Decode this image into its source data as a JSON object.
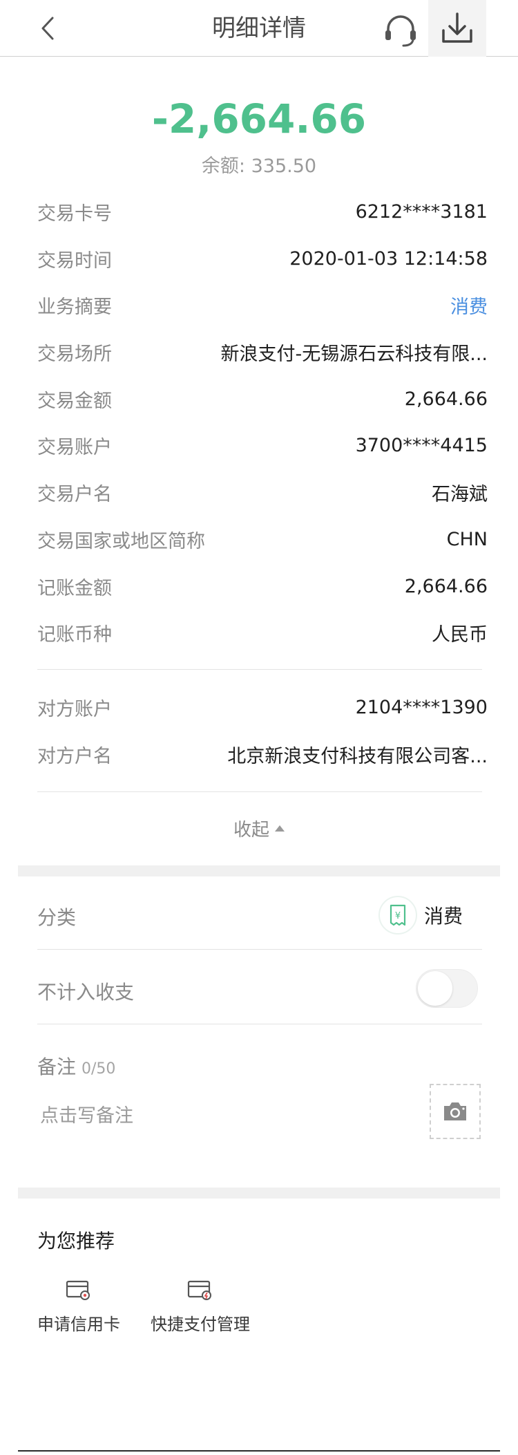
{
  "header": {
    "title": "明细详情",
    "back_icon": "chevron-left-icon",
    "cs_icon": "headset-icon",
    "download_icon": "download-icon"
  },
  "amount": {
    "value": "-2,664.66",
    "balance": "余额: 335.50",
    "color": "#4fc08d"
  },
  "details": [
    {
      "label": "交易卡号",
      "value": "6212****3181"
    },
    {
      "label": "交易时间",
      "value": "2020-01-03 12:14:58"
    },
    {
      "label": "业务摘要",
      "value": "消费",
      "link": true
    },
    {
      "label": "交易场所",
      "value": "新浪支付-无锡源石云科技有限..."
    },
    {
      "label": "交易金额",
      "value": "2,664.66"
    },
    {
      "label": "交易账户",
      "value": "3700****4415"
    },
    {
      "label": "交易户名",
      "value": "石海斌"
    },
    {
      "label": "交易国家或地区简称",
      "value": "CHN"
    },
    {
      "label": "记账金额",
      "value": "2,664.66"
    },
    {
      "label": "记账币种",
      "value": "人民币"
    }
  ],
  "counterparty": [
    {
      "label": "对方账户",
      "value": "2104****1390"
    },
    {
      "label": "对方户名",
      "value": "北京新浪支付科技有限公司客..."
    }
  ],
  "collapse": {
    "label": "收起"
  },
  "category": {
    "label": "分类",
    "value": "消费",
    "icon": "receipt-yuan-icon"
  },
  "exclude": {
    "label": "不计入收支",
    "on": false
  },
  "note": {
    "label": "备注",
    "count": "0/50",
    "placeholder": "点击写备注",
    "value": ""
  },
  "recommend": {
    "title": "为您推荐",
    "items": [
      {
        "label": "申请信用卡",
        "icon": "credit-card-add-icon"
      },
      {
        "label": "快捷支付管理",
        "icon": "card-lightning-icon"
      }
    ]
  },
  "colors": {
    "accent_green": "#4fc08d",
    "link_blue": "#4a8fe0"
  }
}
